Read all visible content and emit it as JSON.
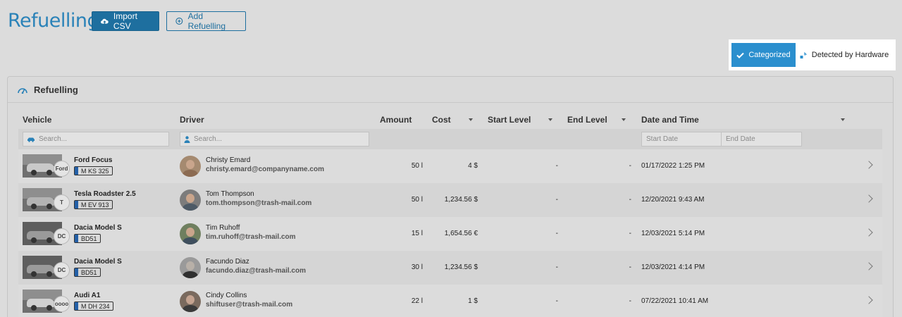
{
  "header": {
    "title": "Refuelling",
    "import_label": "Import CSV",
    "add_label": "Add Refuelling"
  },
  "toggle": {
    "categorized_label": "Categorized",
    "hardware_label": "Detected by Hardware"
  },
  "card": {
    "title": "Refuelling"
  },
  "table": {
    "columns": {
      "vehicle": "Vehicle",
      "driver": "Driver",
      "amount": "Amount",
      "cost": "Cost",
      "start_level": "Start Level",
      "end_level": "End Level",
      "date_time": "Date and Time"
    },
    "filters": {
      "vehicle_placeholder": "Search...",
      "driver_placeholder": "Search...",
      "start_date_placeholder": "Start Date",
      "end_date_placeholder": "End Date"
    },
    "rows": [
      {
        "vehicle": "Ford Focus",
        "plate": "M KS 325",
        "brand": "Ford",
        "driver": "Christy Emard",
        "email": "christy.emard@companyname.com",
        "amount": "50 l",
        "cost": "4 $",
        "start_level": "-",
        "end_level": "-",
        "date": "01/17/2022 1:25 PM"
      },
      {
        "vehicle": "Tesla Roadster 2.5",
        "plate": "M EV 913",
        "brand": "T",
        "driver": "Tom Thompson",
        "email": "tom.thompson@trash-mail.com",
        "amount": "50 l",
        "cost": "1,234.56 $",
        "start_level": "-",
        "end_level": "-",
        "date": "12/20/2021 9:43 AM"
      },
      {
        "vehicle": "Dacia Model S",
        "plate": "BD51",
        "brand": "DC",
        "driver": "Tim Ruhoff",
        "email": "tim.ruhoff@trash-mail.com",
        "amount": "15 l",
        "cost": "1,654.56 €",
        "start_level": "-",
        "end_level": "-",
        "date": "12/03/2021 5:14 PM"
      },
      {
        "vehicle": "Dacia Model S",
        "plate": "BD51",
        "brand": "DC",
        "driver": "Facundo Diaz",
        "email": "facundo.diaz@trash-mail.com",
        "amount": "30 l",
        "cost": "1,234.56 $",
        "start_level": "-",
        "end_level": "-",
        "date": "12/03/2021 4:14 PM"
      },
      {
        "vehicle": "Audi A1",
        "plate": "M DH 234",
        "brand": "oooo",
        "driver": "Cindy Collins",
        "email": "shiftuser@trash-mail.com",
        "amount": "22 l",
        "cost": "1 $",
        "start_level": "-",
        "end_level": "-",
        "date": "07/22/2021 10:41 AM"
      }
    ]
  },
  "colors": {
    "accent": "#2a82b8",
    "button_primary": "#1e6f9f",
    "toggle_active": "#2b8fce"
  },
  "icons": {
    "import": "cloud-upload-icon",
    "add": "plus-circle-icon",
    "categorized": "check-icon",
    "hardware": "signal-icon",
    "card": "fuel-gauge-icon",
    "vehicle_filter": "car-icon",
    "driver_filter": "person-icon",
    "row_action": "chevron-right-icon"
  }
}
